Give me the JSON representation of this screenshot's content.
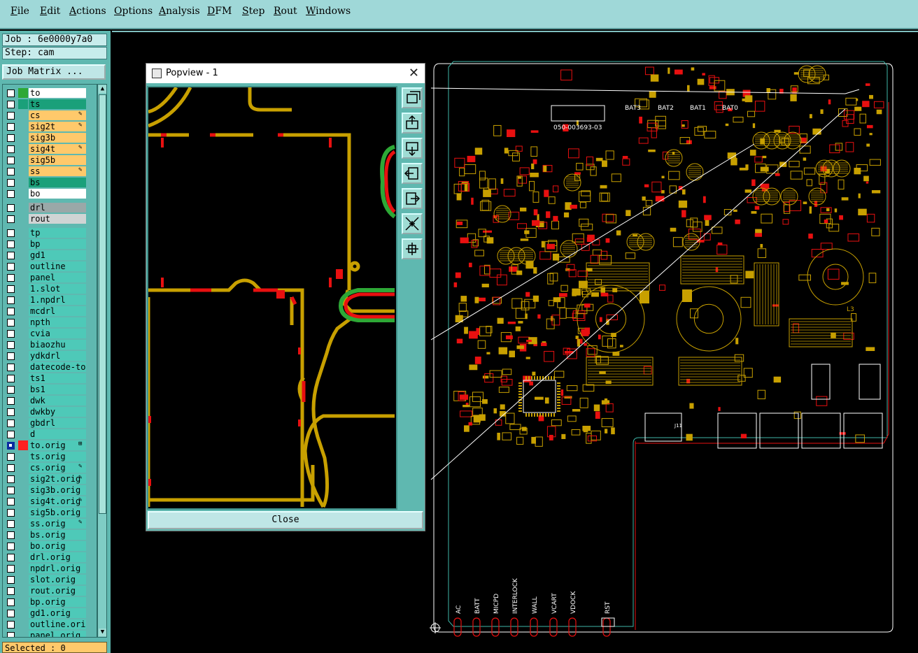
{
  "menu": {
    "items": [
      {
        "label": "File",
        "u": "F"
      },
      {
        "label": "Edit",
        "u": "E"
      },
      {
        "label": "Actions",
        "u": "A"
      },
      {
        "label": "Options",
        "u": "O"
      },
      {
        "label": "Analysis",
        "u": "A"
      },
      {
        "label": "DFM",
        "u": "D"
      },
      {
        "label": "Step",
        "u": "S"
      },
      {
        "label": "Rout",
        "u": "R"
      },
      {
        "label": "Windows",
        "u": "W"
      }
    ]
  },
  "job": {
    "job_label": "Job : 6e0000y7a0",
    "step_label": "Step: cam",
    "matrix_button": "Job Matrix ..."
  },
  "layers": [
    {
      "name": "to",
      "color": "#ffffff",
      "swatch": "#2da836"
    },
    {
      "name": "ts",
      "color": "#1aa07a",
      "swatch": "#1aa07a"
    },
    {
      "name": "cs",
      "color": "#ffc96b",
      "swatch": "",
      "flag": "✎"
    },
    {
      "name": "sig2t",
      "color": "#ffc96b",
      "swatch": "",
      "flag": "✎"
    },
    {
      "name": "sig3b",
      "color": "#ffc96b",
      "swatch": ""
    },
    {
      "name": "sig4t",
      "color": "#ffc96b",
      "swatch": "",
      "flag": "✎"
    },
    {
      "name": "sig5b",
      "color": "#ffc96b",
      "swatch": ""
    },
    {
      "name": "ss",
      "color": "#ffc96b",
      "swatch": "",
      "flag": "✎"
    },
    {
      "name": "bs",
      "color": "#1aa07a",
      "swatch": ""
    },
    {
      "name": "bo",
      "color": "#ffffff",
      "swatch": ""
    },
    {
      "name": "drl",
      "color": "#9aa8a8",
      "swatch": ""
    },
    {
      "name": "rout",
      "color": "#d0d4d4",
      "swatch": ""
    },
    {
      "name": "tp"
    },
    {
      "name": "bp"
    },
    {
      "name": "gd1"
    },
    {
      "name": "outline"
    },
    {
      "name": "panel"
    },
    {
      "name": "1.slot"
    },
    {
      "name": "1.npdrl"
    },
    {
      "name": "mcdrl"
    },
    {
      "name": "npth"
    },
    {
      "name": "cvia"
    },
    {
      "name": "biaozhu"
    },
    {
      "name": "ydkdrl"
    },
    {
      "name": "datecode-to"
    },
    {
      "name": "ts1"
    },
    {
      "name": "bs1"
    },
    {
      "name": "dwk"
    },
    {
      "name": "dwkby"
    },
    {
      "name": "gbdrl"
    },
    {
      "name": "d"
    },
    {
      "name": "to.orig",
      "selected": true,
      "swatch": "#ff2020",
      "flag": "⊞"
    },
    {
      "name": "ts.orig"
    },
    {
      "name": "cs.orig",
      "flag": "✎"
    },
    {
      "name": "sig2t.orig",
      "flag": "✎"
    },
    {
      "name": "sig3b.orig"
    },
    {
      "name": "sig4t.orig",
      "flag": "✎"
    },
    {
      "name": "sig5b.orig"
    },
    {
      "name": "ss.orig",
      "flag": "✎"
    },
    {
      "name": "bs.orig"
    },
    {
      "name": "bo.orig"
    },
    {
      "name": "drl.orig"
    },
    {
      "name": "npdrl.orig"
    },
    {
      "name": "slot.orig"
    },
    {
      "name": "rout.orig"
    },
    {
      "name": "bp.orig"
    },
    {
      "name": "gd1.orig"
    },
    {
      "name": "outline.orig"
    },
    {
      "name": "panel.orig"
    }
  ],
  "status": {
    "selected": "Selected : 0"
  },
  "popview": {
    "title": "Popview - 1",
    "close_label": "Close"
  },
  "pcb": {
    "part_no": "050-003693-03",
    "connectors_top": [
      "BAT3",
      "BAT2",
      "BAT1",
      "BAT0"
    ],
    "connectors_bottom": [
      "AC",
      "BATT",
      "MICPD",
      "INTERLOCK",
      "WALL",
      "VCART",
      "VDOCK",
      "RST"
    ],
    "ref_l3": "L3",
    "ref_j11": "J11"
  },
  "colors": {
    "menubar": "#9fd8d8",
    "panel": "#5fb8b0",
    "copper": "#c8a000",
    "pad_red": "#e81010",
    "green": "#2da836",
    "outline": "#ffffff"
  }
}
